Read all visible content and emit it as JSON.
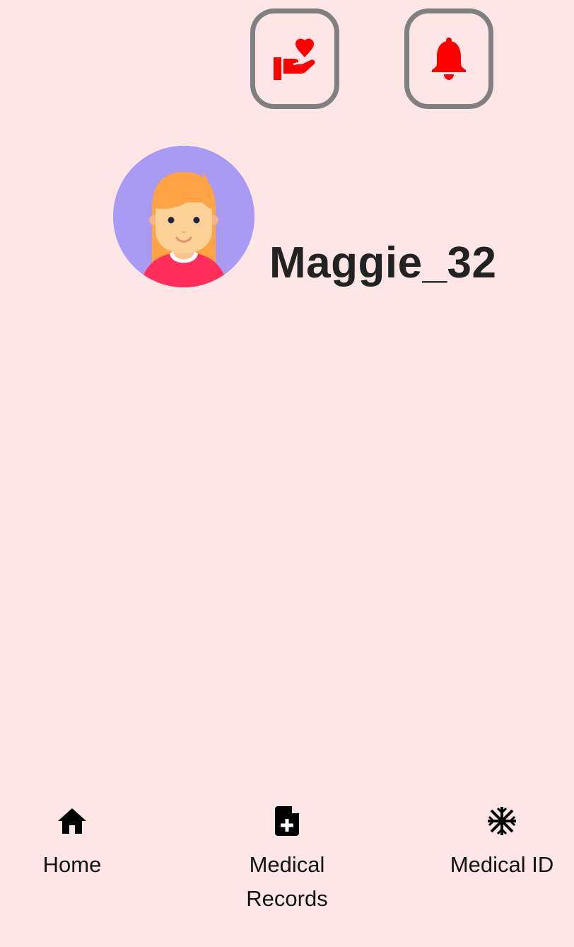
{
  "header": {
    "care_button_icon": "hand-holding-heart-icon",
    "notifications_button_icon": "bell-icon",
    "accent_color": "#ff0000",
    "button_border_color": "#808080"
  },
  "profile": {
    "avatar_icon": "woman-avatar",
    "username": "Maggie_32"
  },
  "bottom_nav": {
    "items": [
      {
        "label": "Home",
        "icon": "home-icon"
      },
      {
        "label": "Medical\nRecords",
        "icon": "medical-file-icon"
      },
      {
        "label": "Medical ID",
        "icon": "asterisk-icon"
      }
    ]
  },
  "colors": {
    "background": "#ffe6e6",
    "avatar_background": "#a99af4"
  }
}
